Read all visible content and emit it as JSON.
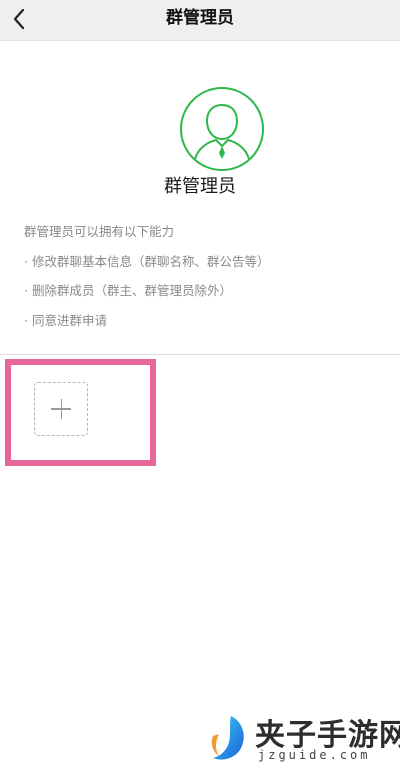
{
  "header": {
    "title": "群管理员",
    "back_icon": "chevron-left-icon"
  },
  "profile": {
    "avatar_icon": "admin-avatar-icon",
    "role_title": "群管理员",
    "accent_color": "#2db84b"
  },
  "description": {
    "intro": "群管理员可以拥有以下能力",
    "abilities": [
      "· 修改群聊基本信息（群聊名称、群公告等）",
      "· 删除群成员（群主、群管理员除外）",
      "· 同意进群申请"
    ]
  },
  "add_admin": {
    "icon": "plus-icon",
    "highlight_color": "#e8679a"
  },
  "watermark": {
    "text": "夹子手游网",
    "subtext": "jzguide.com"
  }
}
